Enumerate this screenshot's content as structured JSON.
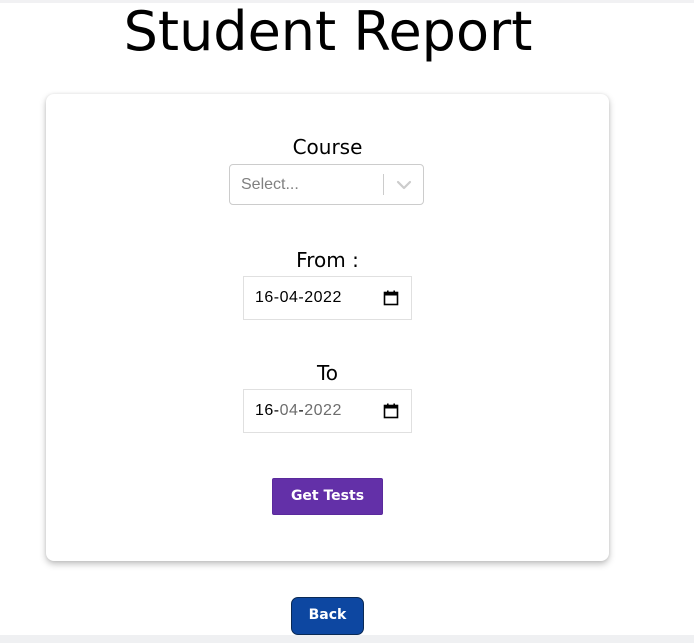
{
  "page": {
    "title": "Student Report"
  },
  "form": {
    "course": {
      "label": "Course",
      "placeholder": "Select..."
    },
    "from": {
      "label": "From :",
      "day": "16",
      "month": "04",
      "year": "2022"
    },
    "to": {
      "label": "To",
      "day": "16",
      "month": "04",
      "year": "2022"
    },
    "submit_label": "Get Tests"
  },
  "footer": {
    "back_label": "Back"
  },
  "colors": {
    "submit_button": "#6330a8",
    "back_button": "#0d47a1",
    "placeholder_text": "#808080"
  },
  "icons": {
    "select_indicator": "chevron-down-icon",
    "date_picker": "calendar-icon"
  }
}
